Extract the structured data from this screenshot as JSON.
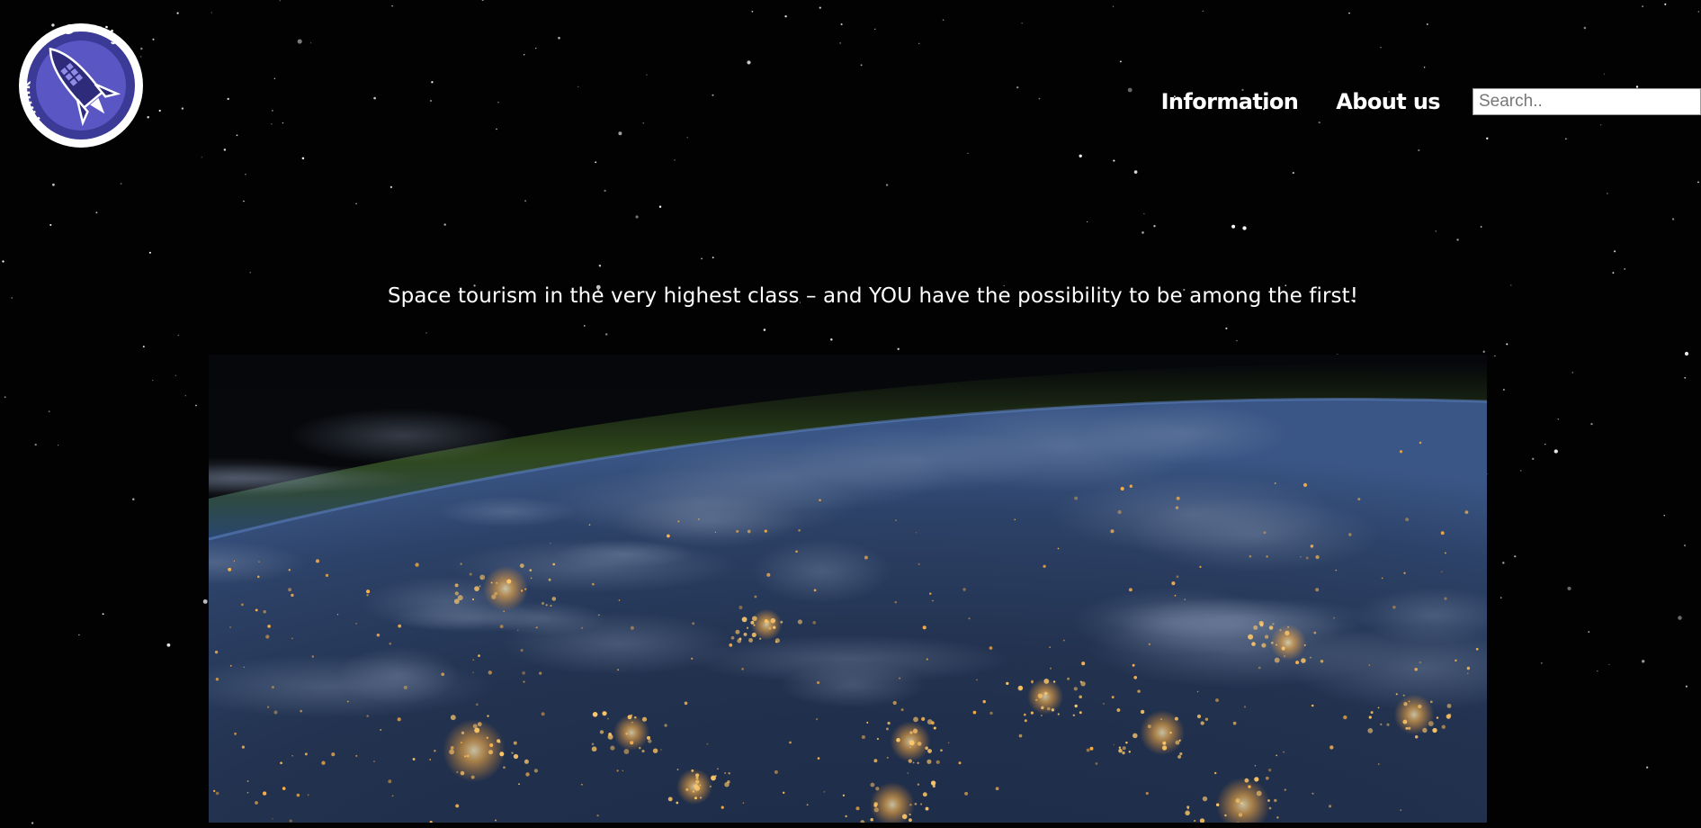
{
  "logo": {
    "top_text": "Gravity",
    "side_text": "Think",
    "ring_color": "#3b3a96",
    "inner_color": "#5a56c4"
  },
  "nav": {
    "items": [
      {
        "label": "Information"
      },
      {
        "label": "About us"
      }
    ],
    "search": {
      "placeholder": "Search..",
      "value": ""
    }
  },
  "hero": {
    "tagline": "Space tourism in the very highest class – and YOU have the possibility to be among the first!",
    "image": "earth-at-night-from-orbit"
  },
  "colors": {
    "background": "#020203",
    "text": "#ffffff",
    "city_lights": "#ffb347",
    "atmosphere": "#4f7a2a"
  }
}
